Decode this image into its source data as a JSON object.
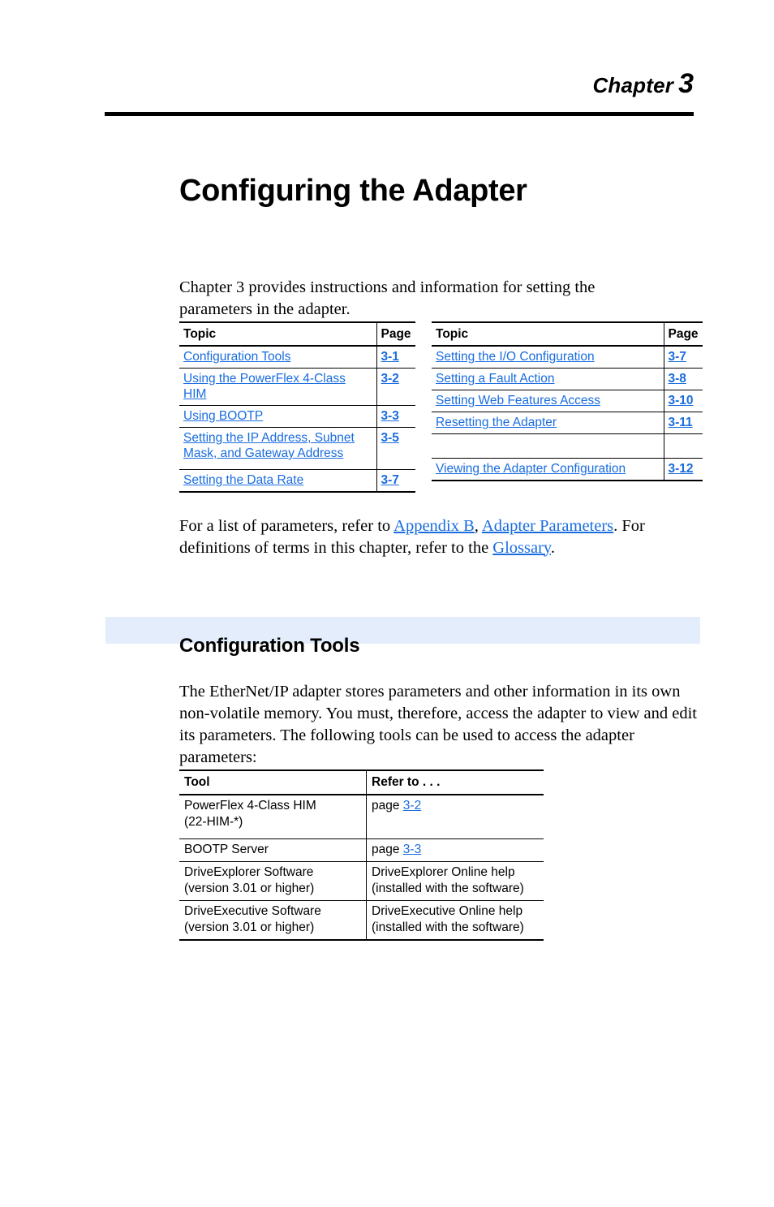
{
  "header": {
    "chapter_word": "Chapter",
    "chapter_number": "3"
  },
  "title": "Configuring the Adapter",
  "intro_paragraph": "Chapter 3 provides instructions and information for setting the parameters in the adapter.",
  "topic_tables": {
    "headers": {
      "topic": "Topic",
      "page": "Page"
    },
    "left_rows": [
      {
        "topic": "Configuration Tools",
        "page": "3-1"
      },
      {
        "topic": "Using the PowerFlex 4-Class HIM",
        "page": "3-2"
      },
      {
        "topic": "Using BOOTP",
        "page": "3-3"
      },
      {
        "topic": "Setting the IP Address, Subnet Mask, and Gateway Address",
        "page": "3-5"
      },
      {
        "topic": "Setting the Data Rate",
        "page": "3-7"
      }
    ],
    "right_rows": [
      {
        "topic": "Setting the I/O Configuration",
        "page": "3-7"
      },
      {
        "topic": "Setting a Fault Action",
        "page": "3-8"
      },
      {
        "topic": "Setting Web Features Access",
        "page": "3-10"
      },
      {
        "topic": "Resetting the Adapter",
        "page": "3-11"
      },
      {
        "topic": "",
        "page": ""
      },
      {
        "topic": "Viewing the Adapter Configuration",
        "page": "3-12"
      }
    ]
  },
  "xref_paragraph": {
    "part1": "For a list of parameters, refer to ",
    "link_appendix": "Appendix B",
    "comma": ", ",
    "link_params": "Adapter Parameters",
    "part2": ". For definitions of terms in this chapter, refer to the ",
    "link_glossary": "Glossary",
    "part3": "."
  },
  "section": {
    "heading": "Configuration Tools",
    "paragraph": "The EtherNet/IP adapter stores parameters and other information in its own non-volatile memory. You must, therefore, access the adapter to view and edit its parameters. The following tools can be used to access the adapter parameters:"
  },
  "tools_table": {
    "headers": {
      "tool": "Tool",
      "refer": "Refer to . . ."
    },
    "rows": [
      {
        "tool_line1": "PowerFlex 4-Class HIM",
        "tool_line2": "(22-HIM-*)",
        "refer_prefix": "page ",
        "refer_link": "3-2",
        "refer_line2": ""
      },
      {
        "tool_line1": "BOOTP Server",
        "tool_line2": "",
        "refer_prefix": "page ",
        "refer_link": "3-3",
        "refer_line2": ""
      },
      {
        "tool_line1": "DriveExplorer Software",
        "tool_line2": "(version 3.01 or higher)",
        "refer_prefix": "DriveExplorer Online help",
        "refer_link": "",
        "refer_line2": "(installed with the software)"
      },
      {
        "tool_line1": "DriveExecutive Software",
        "tool_line2": "(version 3.01 or higher)",
        "refer_prefix": "DriveExecutive Online help",
        "refer_link": "",
        "refer_line2": "(installed with the software)"
      }
    ]
  },
  "colors": {
    "link_blue": "#1a6de0",
    "band_blue": "#e3edfb",
    "rule_black": "#000000"
  }
}
